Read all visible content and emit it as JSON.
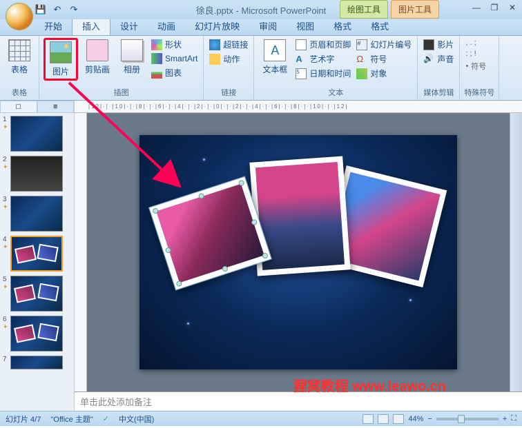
{
  "title": "徐良.pptx - Microsoft PowerPoint",
  "context_tabs": {
    "drawing": "绘图工具",
    "picture": "图片工具"
  },
  "qat": {
    "save": "💾",
    "undo": "↶",
    "redo": "↷"
  },
  "win": {
    "min": "—",
    "restore": "❐",
    "close": "✕"
  },
  "tabs": {
    "home": "开始",
    "insert": "插入",
    "design": "设计",
    "anim": "动画",
    "slideshow": "幻灯片放映",
    "review": "审阅",
    "view": "视图",
    "format1": "格式",
    "format2": "格式"
  },
  "ribbon": {
    "tables": {
      "label": "表格",
      "table": "表格"
    },
    "illus": {
      "label": "插图",
      "picture": "图片",
      "clipart": "剪贴画",
      "album": "相册",
      "shapes": "形状",
      "smartart": "SmartArt",
      "chart": "图表"
    },
    "links": {
      "label": "链接",
      "hyperlink": "超链接",
      "action": "动作"
    },
    "text": {
      "label": "文本",
      "textbox": "文本框",
      "header": "页眉和页脚",
      "wordart": "艺术字",
      "date": "日期和时间",
      "slidenum": "幻灯片编号",
      "symbol": "符号",
      "object": "对象"
    },
    "media": {
      "label": "媒体剪辑",
      "movie": "影片",
      "sound": "声音"
    },
    "special": {
      "label": "特殊符号",
      "symbols": "符号"
    }
  },
  "thumb_tabs": {
    "slides": "□",
    "outline": "≡"
  },
  "ruler": "|12|·|·|10|·|·|8|·|·|6|·|·|4|·|·|2|·|·|0|·|·|2|·|·|4|·|·|6|·|·|8|·|·|10|·|·|12|",
  "notes_placeholder": "单击此处添加备注",
  "watermark": "狸窝教程 www.leawo.cn",
  "status": {
    "slide": "幻灯片 4/7",
    "theme": "\"Office 主题\"",
    "lang": "中文(中国)",
    "zoom": "44%"
  },
  "slide_numbers": [
    "1",
    "2",
    "3",
    "4",
    "5",
    "6",
    "7"
  ]
}
